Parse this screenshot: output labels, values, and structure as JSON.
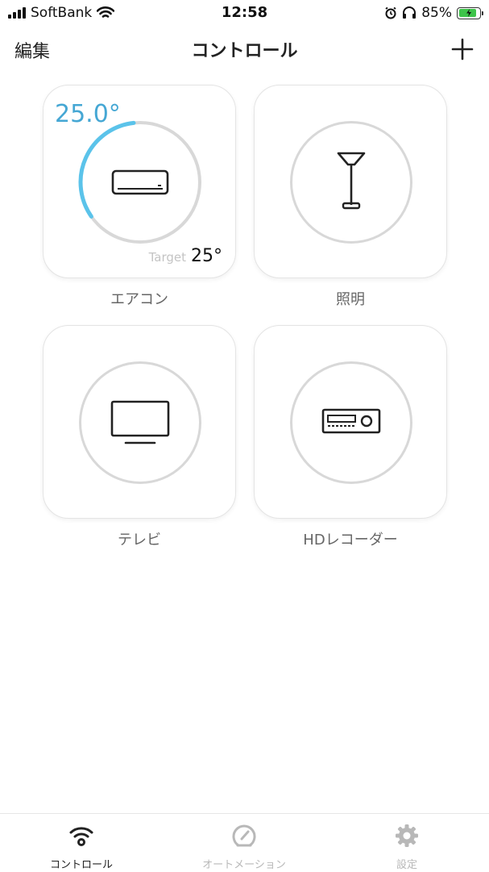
{
  "status_bar": {
    "carrier": "SoftBank",
    "time": "12:58",
    "battery": "85%",
    "battery_level": 0.85
  },
  "nav": {
    "edit_label": "編集",
    "title": "コントロール",
    "add_icon": "plus-icon"
  },
  "devices": [
    {
      "label": "エアコン",
      "icon": "air-conditioner-icon",
      "current_temp": "25.0°",
      "target_label": "Target",
      "target_value": "25°",
      "dial_level": 0.6
    },
    {
      "label": "照明",
      "icon": "floor-lamp-icon"
    },
    {
      "label": "テレビ",
      "icon": "tv-icon"
    },
    {
      "label": "HDレコーダー",
      "icon": "recorder-icon"
    }
  ],
  "tabs": [
    {
      "label": "コントロール",
      "icon": "wifi-icon",
      "active": true
    },
    {
      "label": "オートメーション",
      "icon": "gauge-icon",
      "active": false
    },
    {
      "label": "設定",
      "icon": "gear-icon",
      "active": false
    }
  ],
  "colors": {
    "accent": "#45a7d4",
    "ring": "#d8d8d8",
    "tab_active": "#222222",
    "tab_inactive": "#b8b8b8",
    "battery": "#3ec44a"
  }
}
